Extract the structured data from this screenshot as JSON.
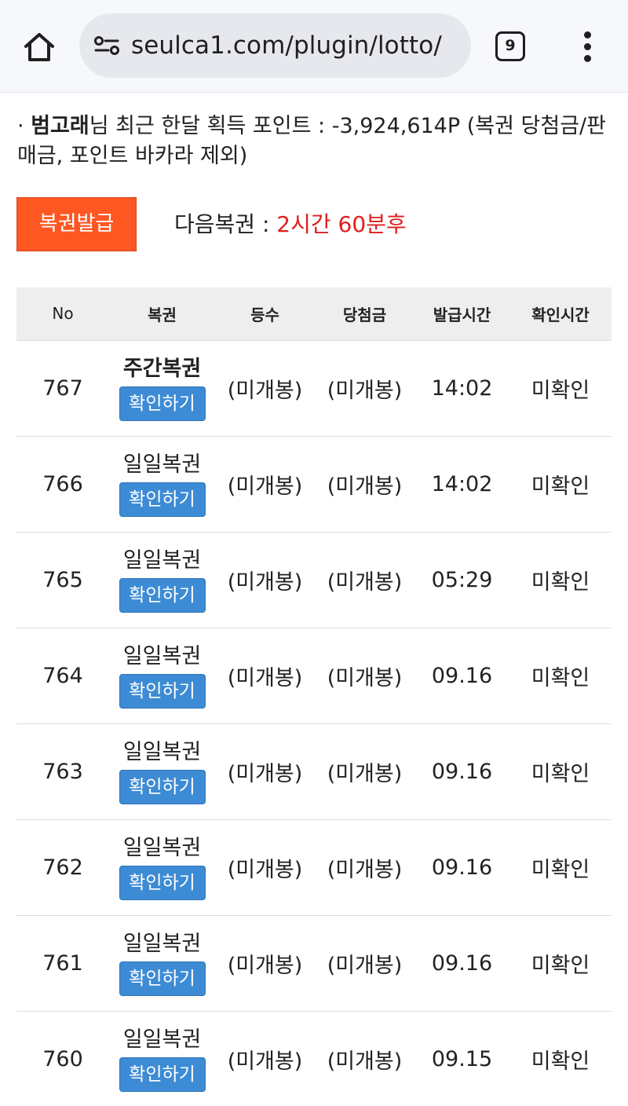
{
  "browser": {
    "url": "seulca1.com/plugin/lotto/",
    "tab_count": "9",
    "icons": {
      "home": "home-icon",
      "site_settings": "tune-icon",
      "menu": "more-vert-icon"
    }
  },
  "points": {
    "bullet": "·",
    "user_name": "범고래",
    "text": "님 최근 한달 획득 포인트 : -3,924,614P (복권 당첨금/판매금, 포인트 바카라 제외)"
  },
  "issue_button_label": "복권발급",
  "next": {
    "label": "다음복권 : ",
    "time": "2시간 60분후"
  },
  "colors": {
    "issue_button": "#ff5722",
    "check_button": "#3d8bd4",
    "status": "#f0a000",
    "next_time": "#e11d1d"
  },
  "table": {
    "headers": [
      "No",
      "복권",
      "등수",
      "당첨금",
      "발급시간",
      "확인시간"
    ],
    "check_label": "확인하기",
    "rows": [
      {
        "no": "767",
        "name": "주간복권",
        "rank": "(미개봉)",
        "prize": "(미개봉)",
        "issued": "14:02",
        "status": "미확인"
      },
      {
        "no": "766",
        "name": "일일복권",
        "rank": "(미개봉)",
        "prize": "(미개봉)",
        "issued": "14:02",
        "status": "미확인"
      },
      {
        "no": "765",
        "name": "일일복권",
        "rank": "(미개봉)",
        "prize": "(미개봉)",
        "issued": "05:29",
        "status": "미확인"
      },
      {
        "no": "764",
        "name": "일일복권",
        "rank": "(미개봉)",
        "prize": "(미개봉)",
        "issued": "09.16",
        "status": "미확인"
      },
      {
        "no": "763",
        "name": "일일복권",
        "rank": "(미개봉)",
        "prize": "(미개봉)",
        "issued": "09.16",
        "status": "미확인"
      },
      {
        "no": "762",
        "name": "일일복권",
        "rank": "(미개봉)",
        "prize": "(미개봉)",
        "issued": "09.16",
        "status": "미확인"
      },
      {
        "no": "761",
        "name": "일일복권",
        "rank": "(미개봉)",
        "prize": "(미개봉)",
        "issued": "09.16",
        "status": "미확인"
      },
      {
        "no": "760",
        "name": "일일복권",
        "rank": "(미개봉)",
        "prize": "(미개봉)",
        "issued": "09.15",
        "status": "미확인"
      }
    ]
  }
}
